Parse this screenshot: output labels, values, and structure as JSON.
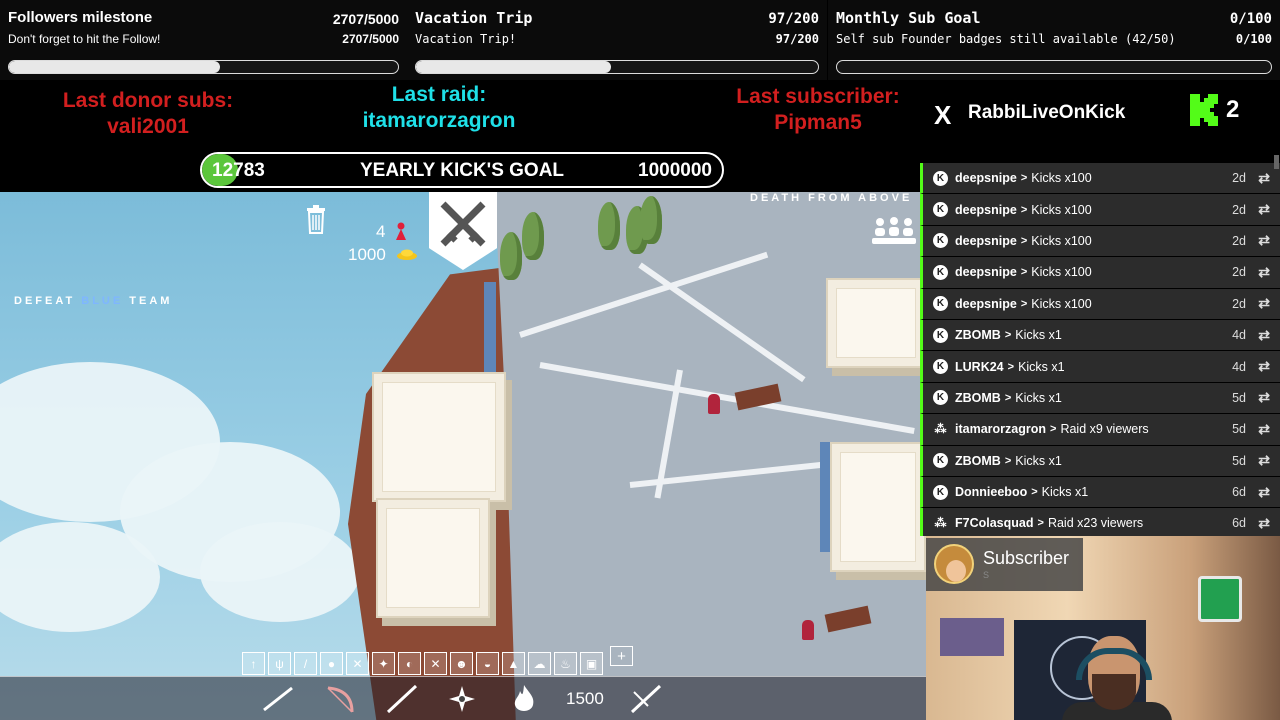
{
  "goals": [
    {
      "title": "Followers milestone",
      "subtitle": "Don't forget to hit the Follow!",
      "count": "2707/5000",
      "count_repeat": "2707/5000",
      "progress": 0.5414
    },
    {
      "title": "Vacation Trip",
      "subtitle": "Vacation Trip!",
      "count": "97/200",
      "count_repeat": "97/200",
      "progress": 0.485
    },
    {
      "title": "Monthly Sub Goal",
      "subtitle": "Self sub Founder badges still available (42/50)",
      "count": "0/100",
      "count_repeat": "0/100",
      "progress": 0.0
    }
  ],
  "stats": {
    "last_donor_label": "Last donor subs:",
    "last_donor_name": "vali2001",
    "last_raid_label": "Last raid:",
    "last_raid_name": "itamarorzagron",
    "last_sub_label": "Last subscriber:",
    "last_sub_name": "Pipman5"
  },
  "yearly_goal": {
    "current": "12783",
    "label": "YEARLY KICK'S GOAL",
    "target": "1000000",
    "progress": 0.0128
  },
  "game": {
    "mode_label": "DEATH FROM ABOVE",
    "objective_prefix": "DEFEAT",
    "objective_team": "BLUE",
    "objective_suffix": "TEAM",
    "unit_count": "4",
    "money": "1000",
    "budget": "1500",
    "toolbar_plus": "+"
  },
  "social": {
    "x_icon": "X",
    "handle": "RabbiLiveOnKick",
    "kick_count": "2"
  },
  "events": [
    {
      "user": "deepsnipe",
      "action": "Kicks x100",
      "time": "2d",
      "type": "kick"
    },
    {
      "user": "deepsnipe",
      "action": "Kicks x100",
      "time": "2d",
      "type": "kick"
    },
    {
      "user": "deepsnipe",
      "action": "Kicks x100",
      "time": "2d",
      "type": "kick"
    },
    {
      "user": "deepsnipe",
      "action": "Kicks x100",
      "time": "2d",
      "type": "kick"
    },
    {
      "user": "deepsnipe",
      "action": "Kicks x100",
      "time": "2d",
      "type": "kick"
    },
    {
      "user": "ZBOMB",
      "action": "Kicks x1",
      "time": "4d",
      "type": "kick"
    },
    {
      "user": "LURK24",
      "action": "Kicks x1",
      "time": "4d",
      "type": "kick"
    },
    {
      "user": "ZBOMB",
      "action": "Kicks x1",
      "time": "5d",
      "type": "kick"
    },
    {
      "user": "itamarorzagron",
      "action": "Raid x9 viewers",
      "time": "5d",
      "type": "raid"
    },
    {
      "user": "ZBOMB",
      "action": "Kicks x1",
      "time": "5d",
      "type": "kick"
    },
    {
      "user": "Donnieeboo",
      "action": "Kicks x1",
      "time": "6d",
      "type": "kick"
    },
    {
      "user": "F7Colasquad",
      "action": "Raid x23 viewers",
      "time": "6d",
      "type": "raid"
    }
  ],
  "subscriber_card": {
    "label": "Subscriber",
    "name": "S"
  },
  "colors": {
    "kick_green": "#53fc18",
    "alert_red": "#d21f1f",
    "raid_cyan": "#1fe0e8",
    "yearly_fill": "#5cc63c"
  }
}
